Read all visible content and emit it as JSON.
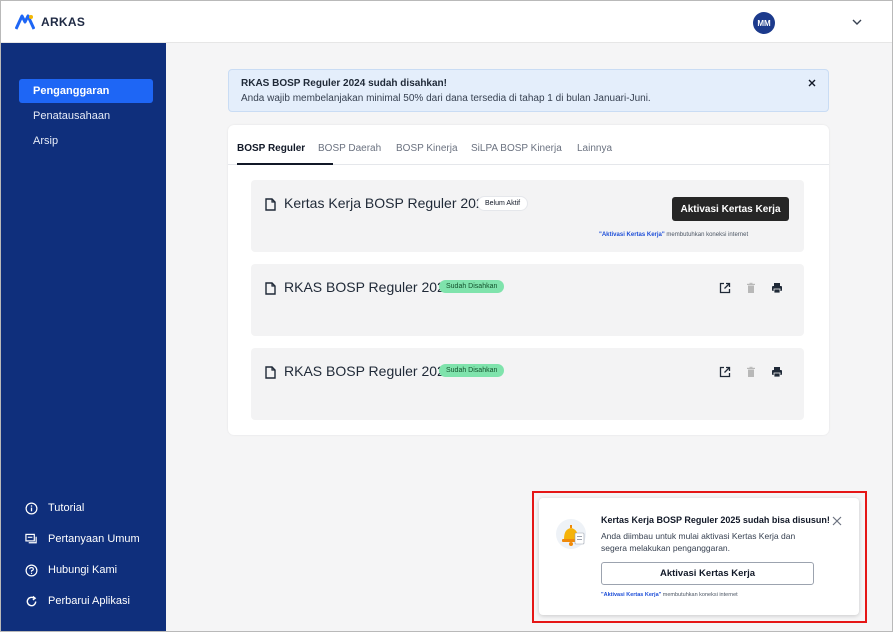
{
  "app": {
    "name": "ARKAS",
    "user_initials": "MM"
  },
  "sidebar": {
    "items": [
      {
        "label": "Penganggaran",
        "active": true
      },
      {
        "label": "Penatausahaan",
        "active": false
      },
      {
        "label": "Arsip",
        "active": false
      }
    ],
    "bottom": [
      {
        "label": "Tutorial",
        "icon": "info-icon"
      },
      {
        "label": "Pertanyaan Umum",
        "icon": "chat-icon"
      },
      {
        "label": "Hubungi Kami",
        "icon": "help-icon"
      },
      {
        "label": "Perbarui Aplikasi",
        "icon": "refresh-icon"
      }
    ]
  },
  "alert": {
    "title": "RKAS BOSP Reguler 2024 sudah disahkan!",
    "text": "Anda wajib membelanjakan minimal 50% dari dana tersedia di tahap 1 di bulan Januari-Juni."
  },
  "tabs": [
    "BOSP Reguler",
    "BOSP Daerah",
    "BOSP Kinerja",
    "SiLPA BOSP Kinerja",
    "Lainnya"
  ],
  "items": [
    {
      "title": "Kertas Kerja BOSP Reguler 2025",
      "badge": "Belum Aktif",
      "button": "Aktivasi Kertas Kerja",
      "note_bold": "\"Aktivasi Kertas Kerja\"",
      "note_rest": " membutuhkan koneksi internet"
    },
    {
      "title": "RKAS BOSP Reguler 2024",
      "badge": "Sudah Disahkan"
    },
    {
      "title": "RKAS BOSP Reguler 2023",
      "badge": "Sudah Disahkan"
    }
  ],
  "toast": {
    "title": "Kertas Kerja BOSP Reguler 2025 sudah bisa disusun!",
    "text": "Anda diimbau untuk mulai aktivasi Kertas Kerja dan segera melakukan penganggaran.",
    "button": "Aktivasi Kertas Kerja",
    "note_bold": "\"Aktivasi Kertas Kerja\"",
    "note_rest": " membutuhkan koneksi internet"
  },
  "colors": {
    "sidebar": "#0f2f7c",
    "active_nav": "#1e66f5",
    "badge_green": "#7fe3ac",
    "highlight": "#e51616"
  }
}
